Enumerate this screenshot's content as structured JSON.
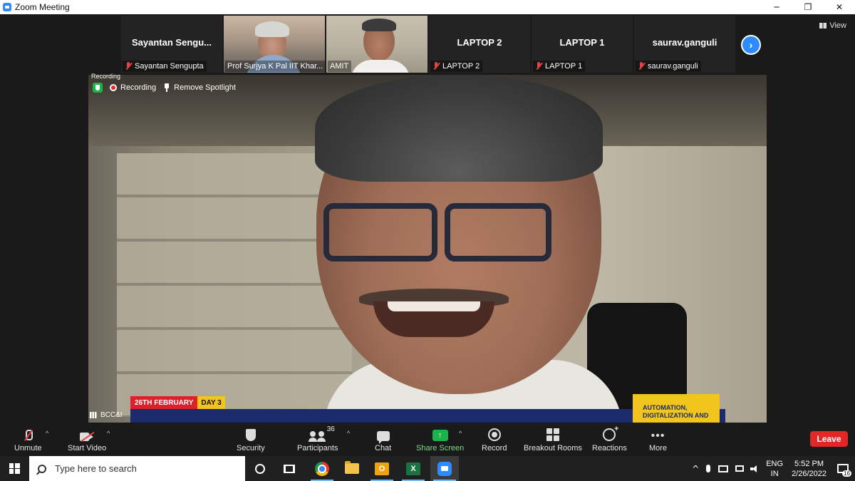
{
  "window": {
    "title": "Zoom Meeting",
    "minimize": "─",
    "restore": "❐",
    "close": "✕"
  },
  "view_button": "View",
  "thumbnails": [
    {
      "name": "Sayantan Sengu...",
      "label": "Sayantan Sengupta",
      "video": false,
      "muted": true
    },
    {
      "name": "",
      "label": "Prof Surjya K Pal IIT Khar...",
      "video": true,
      "muted": false
    },
    {
      "name": "",
      "label": "AMIT",
      "video": true,
      "muted": false
    },
    {
      "name": "LAPTOP 2",
      "label": "LAPTOP 2",
      "video": false,
      "muted": true
    },
    {
      "name": "LAPTOP 1",
      "label": "LAPTOP 1",
      "video": false,
      "muted": true
    },
    {
      "name": "saurav.ganguli",
      "label": "saurav.ganguli",
      "video": false,
      "muted": true
    }
  ],
  "next_page_icon": "chevron-right",
  "main_video": {
    "recording_tiny": "Recording",
    "recording": "Recording",
    "remove_spotlight": "Remove Spotlight",
    "banner_date": "26TH FEBRUARY",
    "banner_day": "DAY 3",
    "banner_box_line1": "AUTOMATION,",
    "banner_box_line2": "DIGITALIZATION AND",
    "speaker_label": "BCC&I"
  },
  "toolbar": {
    "unmute": "Unmute",
    "start_video": "Start Video",
    "security": "Security",
    "participants": "Participants",
    "participants_count": "36",
    "chat": "Chat",
    "share_screen": "Share Screen",
    "record": "Record",
    "breakout_rooms": "Breakout Rooms",
    "reactions": "Reactions",
    "more": "More",
    "more_glyph": "•••",
    "leave": "Leave",
    "caret": "^"
  },
  "taskbar": {
    "search_placeholder": "Type here to search",
    "lang_line1": "ENG",
    "lang_line2": "IN",
    "time": "5:52 PM",
    "date": "2/26/2022",
    "notification_count": "16",
    "tray_up": "^"
  },
  "colors": {
    "accent": "#2d8cff",
    "leave": "#e02828",
    "share": "#1bb34a",
    "muted": "#e84141"
  }
}
